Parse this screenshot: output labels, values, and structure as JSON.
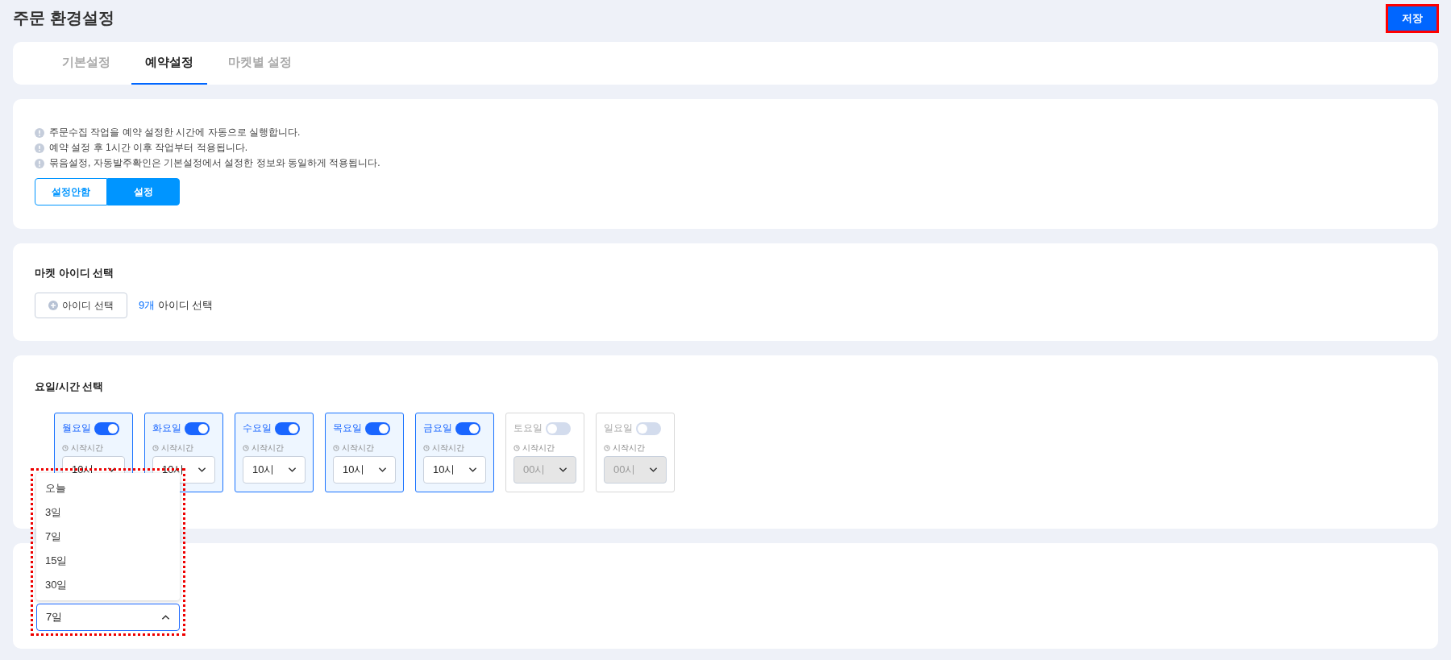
{
  "page": {
    "title": "주문 환경설정",
    "save_button": "저장"
  },
  "tabs": [
    {
      "label": "기본설정",
      "selected": false
    },
    {
      "label": "예약설정",
      "selected": true
    },
    {
      "label": "마켓별 설정",
      "selected": false
    }
  ],
  "notices": [
    "주문수집 작업을 예약 설정한 시간에 자동으로 실행합니다.",
    "예약 설정 후 1시간 이후 작업부터 적용됩니다.",
    "묶음설정, 자동발주확인은 기본설정에서 설정한 정보와 동일하게 적용됩니다."
  ],
  "schedule_mode": [
    {
      "label": "설정안함",
      "selected": false
    },
    {
      "label": "설정",
      "selected": true
    }
  ],
  "market_ids": {
    "title": "마켓 아이디 선택",
    "button": "아이디 선택",
    "count": "9개",
    "count_suffix": "아이디 선택"
  },
  "days": {
    "title": "요일/시간 선택",
    "items": [
      {
        "name": "월요일",
        "on": true,
        "time_label": "시작시간",
        "time": "10시"
      },
      {
        "name": "화요일",
        "on": true,
        "time_label": "시작시간",
        "time": "10시"
      },
      {
        "name": "수요일",
        "on": true,
        "time_label": "시작시간",
        "time": "10시"
      },
      {
        "name": "목요일",
        "on": true,
        "time_label": "시작시간",
        "time": "10시"
      },
      {
        "name": "금요일",
        "on": true,
        "time_label": "시작시간",
        "time": "10시"
      },
      {
        "name": "토요일",
        "on": false,
        "time_label": "시작시간",
        "time": "00시"
      },
      {
        "name": "일요일",
        "on": false,
        "time_label": "시작시간",
        "time": "00시"
      }
    ]
  },
  "period_dropdown": {
    "value": "7일",
    "expanded": true,
    "options": [
      "오늘",
      "3일",
      "7일",
      "15일",
      "30일"
    ]
  }
}
